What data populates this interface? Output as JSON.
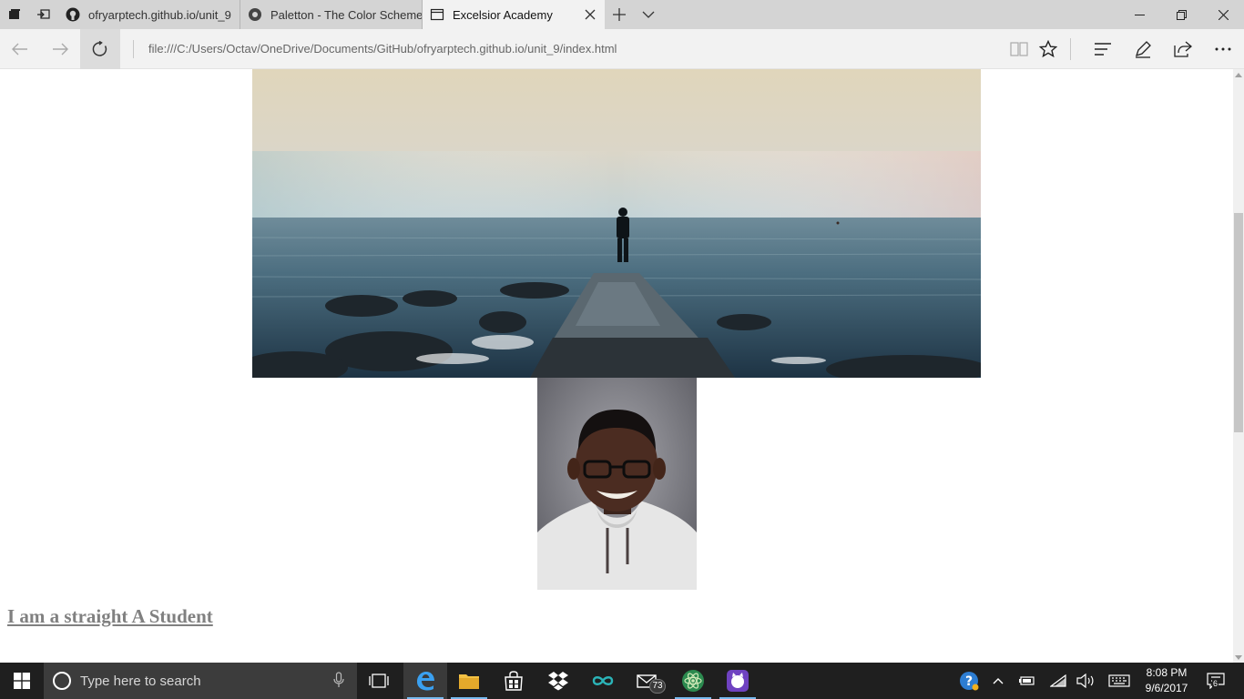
{
  "browser": {
    "tabs": [
      {
        "label": "ofryarptech.github.io/unit_9",
        "icon": "github-icon",
        "active": false
      },
      {
        "label": "Paletton - The Color Scheme Designer",
        "icon": "paletton-icon",
        "active": false
      },
      {
        "label": "Excelsior Academy",
        "icon": "page-icon",
        "active": true
      }
    ],
    "address": "file:///C:/Users/Octav/OneDrive/Documents/GitHub/ofryarptech.github.io/unit_9/index.html"
  },
  "page": {
    "hero_image": "Person standing at the end of a stone pier looking out over the sea",
    "portrait_image": "Student portrait wearing glasses and a white hoodie",
    "link_text": "I am a straight A Student",
    "link_color": "#808080"
  },
  "taskbar": {
    "search_placeholder": "Type here to search",
    "mail_badge": "73",
    "time": "8:08 PM",
    "date": "9/6/2017",
    "notifications": "6",
    "accent": "#76b9ed"
  }
}
